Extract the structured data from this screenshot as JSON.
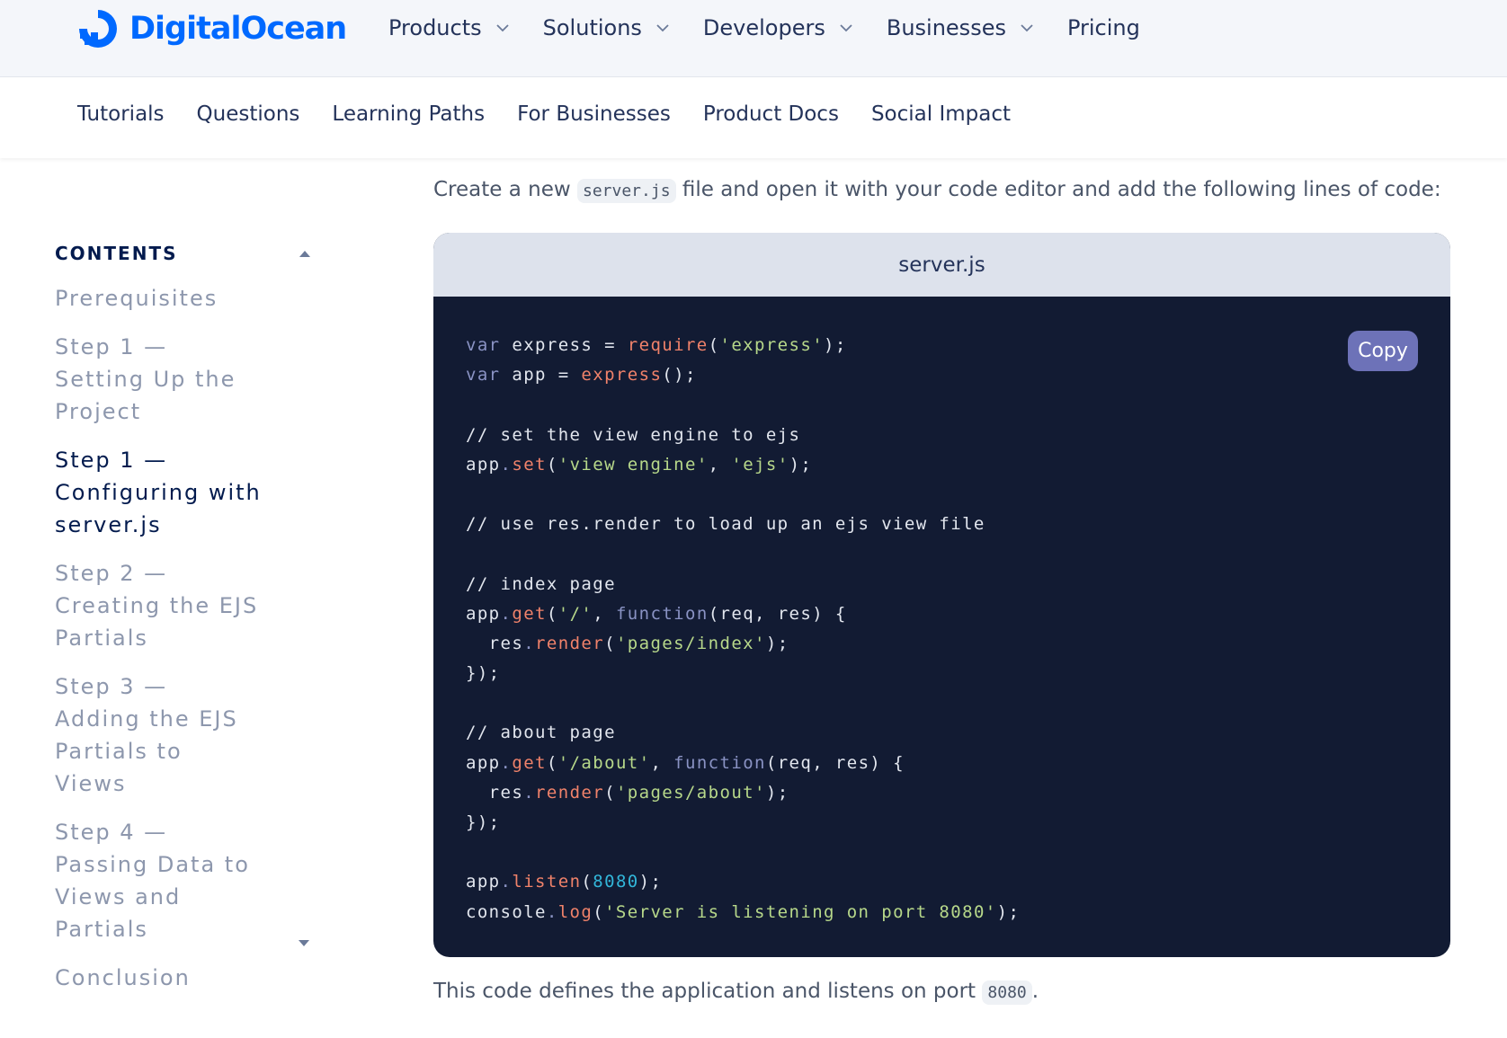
{
  "brand": {
    "name": "DigitalOcean",
    "color": "#0069ff",
    "logo_icon": "digitalocean-logo-icon"
  },
  "topnav": {
    "items": [
      {
        "label": "Products",
        "has_dropdown": true
      },
      {
        "label": "Solutions",
        "has_dropdown": true
      },
      {
        "label": "Developers",
        "has_dropdown": true
      },
      {
        "label": "Businesses",
        "has_dropdown": true
      },
      {
        "label": "Pricing",
        "has_dropdown": false
      }
    ]
  },
  "subnav": {
    "items": [
      "Tutorials",
      "Questions",
      "Learning Paths",
      "For Businesses",
      "Product Docs",
      "Social Impact"
    ]
  },
  "toc": {
    "title": "CONTENTS",
    "items": [
      {
        "label": "Prerequisites",
        "active": false
      },
      {
        "label": "Step 1 — Setting Up the Project",
        "active": false
      },
      {
        "label": "Step 1 — Configuring with server.js",
        "active": true
      },
      {
        "label": "Step 2 — Creating the EJS Partials",
        "active": false
      },
      {
        "label": "Step 3 — Adding the EJS Partials to Views",
        "active": false
      },
      {
        "label": "Step 4 — Passing Data to Views and Partials",
        "active": false
      },
      {
        "label": "Conclusion",
        "active": false
      }
    ]
  },
  "main": {
    "intro_before": "Create a new ",
    "intro_code": "server.js",
    "intro_after": " file and open it with your code editor and add the following lines of code:",
    "code": {
      "filename": "server.js",
      "copy_label": "Copy",
      "lines": [
        [
          [
            "kw",
            "var"
          ],
          [
            "t",
            " express = "
          ],
          [
            "fn",
            "require"
          ],
          [
            "t",
            "("
          ],
          [
            "str",
            "'express'"
          ],
          [
            "t",
            ");"
          ]
        ],
        [
          [
            "kw",
            "var"
          ],
          [
            "t",
            " app = "
          ],
          [
            "fn",
            "express"
          ],
          [
            "t",
            "();"
          ]
        ],
        [],
        [
          [
            "cm",
            "// set the view engine to ejs"
          ]
        ],
        [
          [
            "t",
            "app"
          ],
          [
            "kw",
            "."
          ],
          [
            "fn",
            "set"
          ],
          [
            "t",
            "("
          ],
          [
            "str",
            "'view engine'"
          ],
          [
            "t",
            ", "
          ],
          [
            "str",
            "'ejs'"
          ],
          [
            "t",
            ");"
          ]
        ],
        [],
        [
          [
            "cm",
            "// use res.render to load up an ejs view file"
          ]
        ],
        [],
        [
          [
            "cm",
            "// index page"
          ]
        ],
        [
          [
            "t",
            "app"
          ],
          [
            "kw",
            "."
          ],
          [
            "fn",
            "get"
          ],
          [
            "t",
            "("
          ],
          [
            "str",
            "'/'"
          ],
          [
            "t",
            ", "
          ],
          [
            "kw",
            "function"
          ],
          [
            "t",
            "(req, res) {"
          ]
        ],
        [
          [
            "t",
            "  res"
          ],
          [
            "kw",
            "."
          ],
          [
            "fn",
            "render"
          ],
          [
            "t",
            "("
          ],
          [
            "str",
            "'pages/index'"
          ],
          [
            "t",
            ");"
          ]
        ],
        [
          [
            "t",
            "});"
          ]
        ],
        [],
        [
          [
            "cm",
            "// about page"
          ]
        ],
        [
          [
            "t",
            "app"
          ],
          [
            "kw",
            "."
          ],
          [
            "fn",
            "get"
          ],
          [
            "t",
            "("
          ],
          [
            "str",
            "'/about'"
          ],
          [
            "t",
            ", "
          ],
          [
            "kw",
            "function"
          ],
          [
            "t",
            "(req, res) {"
          ]
        ],
        [
          [
            "t",
            "  res"
          ],
          [
            "kw",
            "."
          ],
          [
            "fn",
            "render"
          ],
          [
            "t",
            "("
          ],
          [
            "str",
            "'pages/about'"
          ],
          [
            "t",
            ");"
          ]
        ],
        [
          [
            "t",
            "});"
          ]
        ],
        [],
        [
          [
            "t",
            "app"
          ],
          [
            "kw",
            "."
          ],
          [
            "fn",
            "listen"
          ],
          [
            "t",
            "("
          ],
          [
            "num",
            "8080"
          ],
          [
            "t",
            ");"
          ]
        ],
        [
          [
            "t",
            "console"
          ],
          [
            "kw",
            "."
          ],
          [
            "fn",
            "log"
          ],
          [
            "t",
            "("
          ],
          [
            "str",
            "'Server is listening on port 8080'"
          ],
          [
            "t",
            ");"
          ]
        ]
      ]
    },
    "outro_before": "This code defines the application and listens on port ",
    "outro_code": "8080",
    "outro_after": "."
  }
}
